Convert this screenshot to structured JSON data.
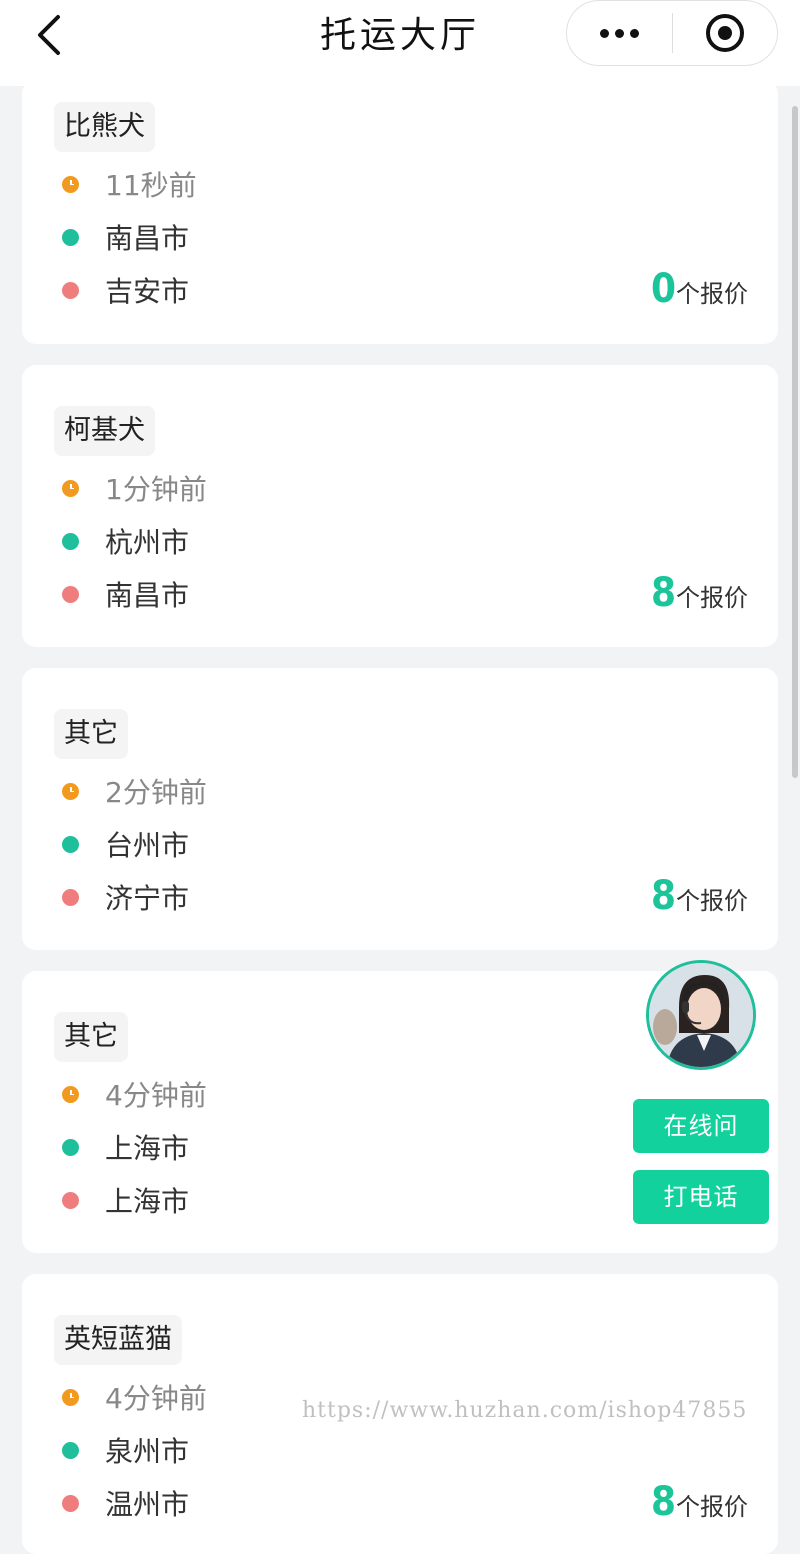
{
  "nav": {
    "title": "托运大厅"
  },
  "orders": [
    {
      "category": "比熊犬",
      "time": "11秒前",
      "from": "南昌市",
      "to": "吉安市",
      "quote_count": "0",
      "quote_label": "个报价"
    },
    {
      "category": "柯基犬",
      "time": "1分钟前",
      "from": "杭州市",
      "to": "南昌市",
      "quote_count": "8",
      "quote_label": "个报价"
    },
    {
      "category": "其它",
      "time": "2分钟前",
      "from": "台州市",
      "to": "济宁市",
      "quote_count": "8",
      "quote_label": "个报价"
    },
    {
      "category": "其它",
      "time": "4分钟前",
      "from": "上海市",
      "to": "上海市"
    },
    {
      "category": "英短蓝猫",
      "time": "4分钟前",
      "from": "泉州市",
      "to": "温州市",
      "quote_count": "8",
      "quote_label": "个报价"
    }
  ],
  "service": {
    "online_label": "在线问",
    "call_label": "打电话"
  },
  "watermark": "https://www.huzhan.com/ishop47855",
  "colors": {
    "accent": "#1cc49a",
    "time_dot": "#f29a1f",
    "origin_dot": "#1fbf9b",
    "destination_dot": "#f07d7d"
  }
}
